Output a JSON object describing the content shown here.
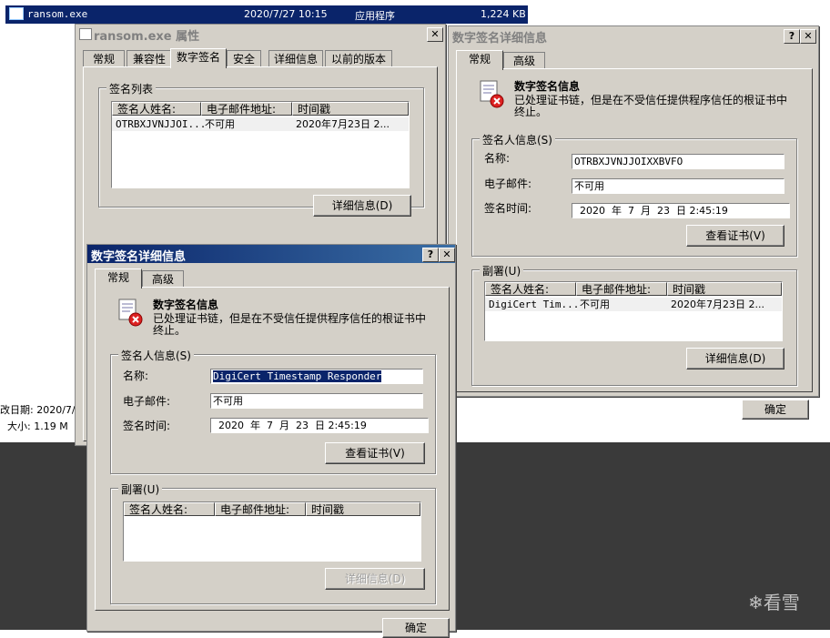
{
  "file_row": {
    "name": "ransom.exe",
    "date": "2020/7/27 10:15",
    "type": "应用程序",
    "size": "1,224 KB"
  },
  "bg_details": {
    "modified_label": "改日期: 2020/7/",
    "size_label": "大小: 1.19 M"
  },
  "watermark": "看雪",
  "properties": {
    "title": "ransom.exe 属性",
    "tabs": [
      "常规",
      "兼容性",
      "数字签名",
      "安全",
      "详细信息",
      "以前的版本"
    ],
    "selected_tab": "数字签名",
    "sig_list_label": "签名列表",
    "columns": [
      "签名人姓名:",
      "电子邮件地址:",
      "时间戳"
    ],
    "row": {
      "name": "OTRBXJVNJJOI...",
      "email": "不可用",
      "time": "2020年7月23日 2..."
    },
    "details_button": "详细信息(D)"
  },
  "detail_right": {
    "title": "数字签名详细信息",
    "tabs": [
      "常规",
      "高级"
    ],
    "heading": "数字签名信息",
    "desc_line1": "已处理证书链，但是在不受信任提供程序信任的根证书中",
    "desc_line2": "终止。",
    "signer_group": "签名人信息(S)",
    "name_label": "名称:",
    "name_value": "OTRBXJVNJJOIXXBVFO",
    "email_label": "电子邮件:",
    "email_value": "不可用",
    "time_label": "签名时间:",
    "time_value": "2020  年  7  月  23  日 2:45:19",
    "view_cert_button": "查看证书(V)",
    "countersig_group": "副署(U)",
    "columns": [
      "签名人姓名:",
      "电子邮件地址:",
      "时间戳"
    ],
    "row": {
      "name": "DigiCert Tim...",
      "email": "不可用",
      "time": "2020年7月23日 2..."
    },
    "details_button": "详细信息(D)",
    "ok_button": "确定"
  },
  "detail_front": {
    "title": "数字签名详细信息",
    "tabs": [
      "常规",
      "高级"
    ],
    "heading": "数字签名信息",
    "desc_line1": "已处理证书链，但是在不受信任提供程序信任的根证书中",
    "desc_line2": "终止。",
    "signer_group": "签名人信息(S)",
    "name_label": "名称:",
    "name_value": "DigiCert Timestamp Responder",
    "email_label": "电子邮件:",
    "email_value": "不可用",
    "time_label": "签名时间:",
    "time_value": "2020  年  7  月  23  日 2:45:19",
    "view_cert_button": "查看证书(V)",
    "countersig_group": "副署(U)",
    "columns": [
      "签名人姓名:",
      "电子邮件地址:",
      "时间戳"
    ],
    "details_button": "详细信息(D)",
    "ok_button": "确定"
  },
  "colors": {
    "active_title": "#0a246a",
    "dialog_bg": "#d4d0c8",
    "desktop": "#3a3a3a"
  }
}
